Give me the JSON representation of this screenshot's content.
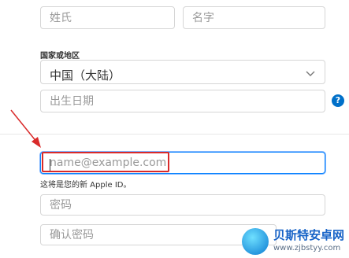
{
  "form": {
    "last_name": {
      "placeholder": "姓氏"
    },
    "first_name": {
      "placeholder": "名字"
    },
    "country_label": "国家或地区",
    "country_value": "中国（大陆）",
    "birthday": {
      "placeholder": "出生日期"
    },
    "help_glyph": "?",
    "email": {
      "placeholder": "name@example.com"
    },
    "email_hint": "这将是您的新 Apple ID。",
    "password": {
      "placeholder": "密码"
    },
    "confirm_password": {
      "placeholder": "确认密码"
    }
  },
  "annotation": {
    "highlight_color": "#d92a2a",
    "arrow_color": "#d92a2a"
  },
  "watermark": {
    "title": "贝斯特安卓网",
    "url": "www.zjbstyy.com"
  },
  "colors": {
    "accent": "#0070c9",
    "focus": "#0a84ff"
  }
}
